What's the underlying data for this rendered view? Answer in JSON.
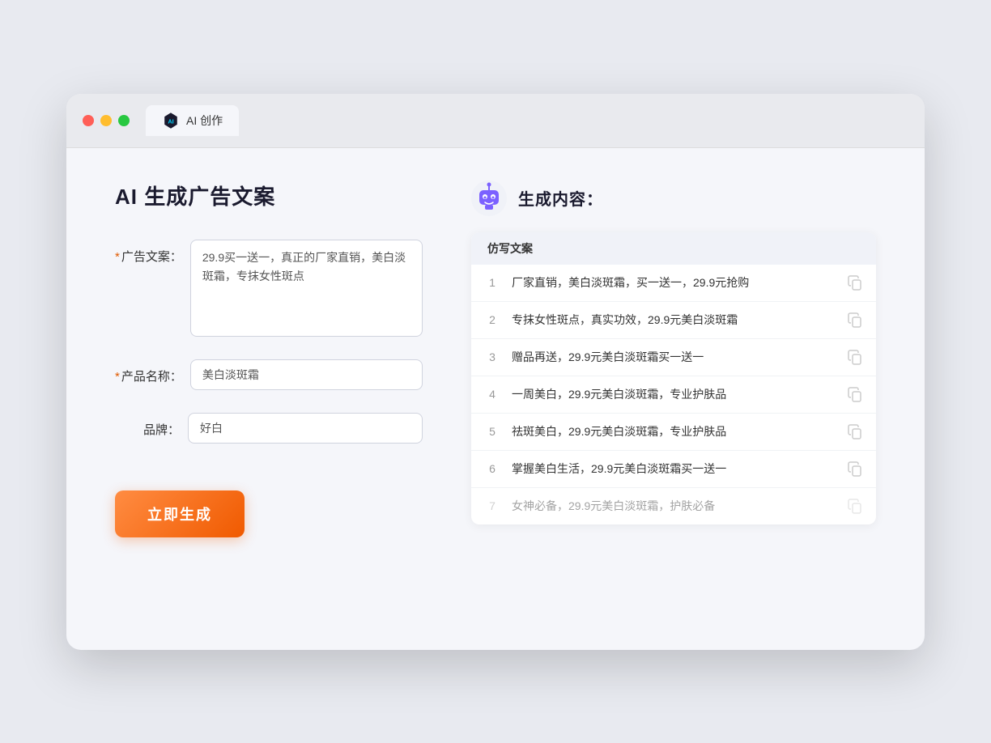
{
  "browser": {
    "tab_label": "AI 创作"
  },
  "page": {
    "title": "AI 生成广告文案",
    "result_title": "生成内容："
  },
  "form": {
    "ad_copy_label": "广告文案：",
    "ad_copy_required": "*",
    "ad_copy_value": "29.9买一送一，真正的厂家直销，美白淡斑霜，专抹女性斑点",
    "product_name_label": "产品名称：",
    "product_name_required": "*",
    "product_name_value": "美白淡斑霜",
    "brand_label": "品牌：",
    "brand_value": "好白",
    "generate_btn": "立即生成"
  },
  "results": {
    "column_header": "仿写文案",
    "items": [
      {
        "num": "1",
        "text": "厂家直销，美白淡斑霜，买一送一，29.9元抢购"
      },
      {
        "num": "2",
        "text": "专抹女性斑点，真实功效，29.9元美白淡斑霜"
      },
      {
        "num": "3",
        "text": "赠品再送，29.9元美白淡斑霜买一送一"
      },
      {
        "num": "4",
        "text": "一周美白，29.9元美白淡斑霜，专业护肤品"
      },
      {
        "num": "5",
        "text": "祛斑美白，29.9元美白淡斑霜，专业护肤品"
      },
      {
        "num": "6",
        "text": "掌握美白生活，29.9元美白淡斑霜买一送一"
      },
      {
        "num": "7",
        "text": "女神必备，29.9元美白淡斑霜，护肤必备"
      }
    ]
  }
}
